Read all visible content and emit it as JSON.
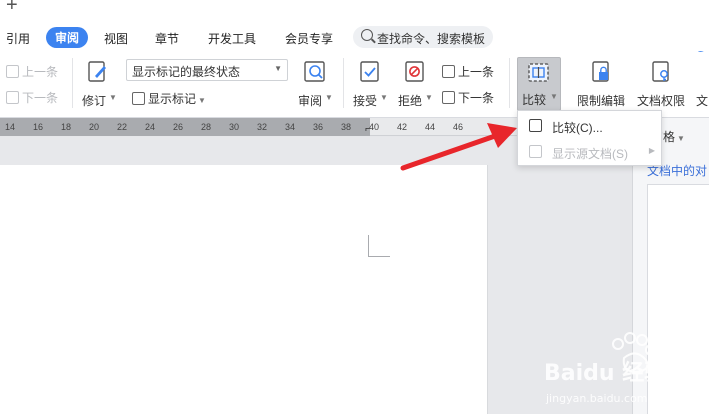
{
  "titlebar": {
    "new_tab_symbol": "+"
  },
  "menubar": {
    "items": [
      {
        "label": "引用"
      },
      {
        "label": "审阅",
        "active": true
      },
      {
        "label": "视图"
      },
      {
        "label": "章节"
      },
      {
        "label": "开发工具"
      },
      {
        "label": "会员专享"
      }
    ],
    "search_placeholder": "查找命令、搜索模板"
  },
  "ribbon": {
    "prev_item": "上一条",
    "next_item": "下一条",
    "track_changes": "修订",
    "markup_state": "显示标记的最终状态",
    "show_markup": "显示标记",
    "review": "审阅",
    "accept": "接受",
    "reject": "拒绝",
    "prev_change": "上一条",
    "next_change": "下一条",
    "compare": "比较",
    "restrict_editing": "限制编辑",
    "doc_permissions": "文档权限",
    "doc_partial": "文"
  },
  "ruler": {
    "ticks": [
      "14",
      "16",
      "18",
      "20",
      "22",
      "24",
      "26",
      "28",
      "30",
      "32",
      "34",
      "36",
      "38",
      "40",
      "42",
      "44",
      "46"
    ]
  },
  "compare_menu": {
    "items": [
      {
        "label": "比较(C)...",
        "enabled": true
      },
      {
        "label": "显示源文档(S)",
        "enabled": false
      }
    ]
  },
  "side_panel": {
    "title": "择窗格",
    "link_text": "文档中的对"
  },
  "watermark": {
    "brand": "Baidu 经验",
    "url": "jingyan.baidu.com"
  },
  "colors": {
    "accent": "#3c83f0",
    "arrow": "#e8262b",
    "link": "#3a6fd8"
  }
}
